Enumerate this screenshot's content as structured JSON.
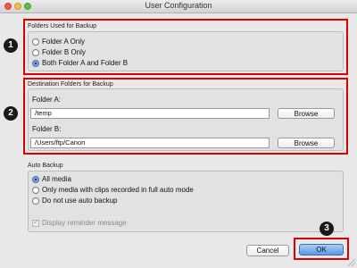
{
  "window": {
    "title": "User Configuration"
  },
  "folders_used": {
    "label": "Folders Used for Backup",
    "options": [
      {
        "label": "Folder A Only",
        "selected": false
      },
      {
        "label": "Folder B Only",
        "selected": false
      },
      {
        "label": "Both Folder A and Folder B",
        "selected": true
      }
    ]
  },
  "destination": {
    "label": "Destination Folders for Backup",
    "folder_a": {
      "label": "Folder A:",
      "value": "/temp",
      "browse": "Browse"
    },
    "folder_b": {
      "label": "Folder B:",
      "value": "/Users/ftp/Canon",
      "browse": "Browse"
    }
  },
  "auto_backup": {
    "label": "Auto Backup",
    "options": [
      {
        "label": "All media",
        "selected": true
      },
      {
        "label": "Only media with clips recorded in full auto mode",
        "selected": false
      },
      {
        "label": "Do not use auto backup",
        "selected": false
      }
    ],
    "reminder": {
      "label": "Display reminder message",
      "checked": true,
      "disabled": true
    }
  },
  "buttons": {
    "cancel": "Cancel",
    "ok": "OK"
  },
  "callouts": [
    "1",
    "2",
    "3"
  ],
  "colors": {
    "highlight": "#dd0000",
    "accent": "#5a9be6"
  }
}
